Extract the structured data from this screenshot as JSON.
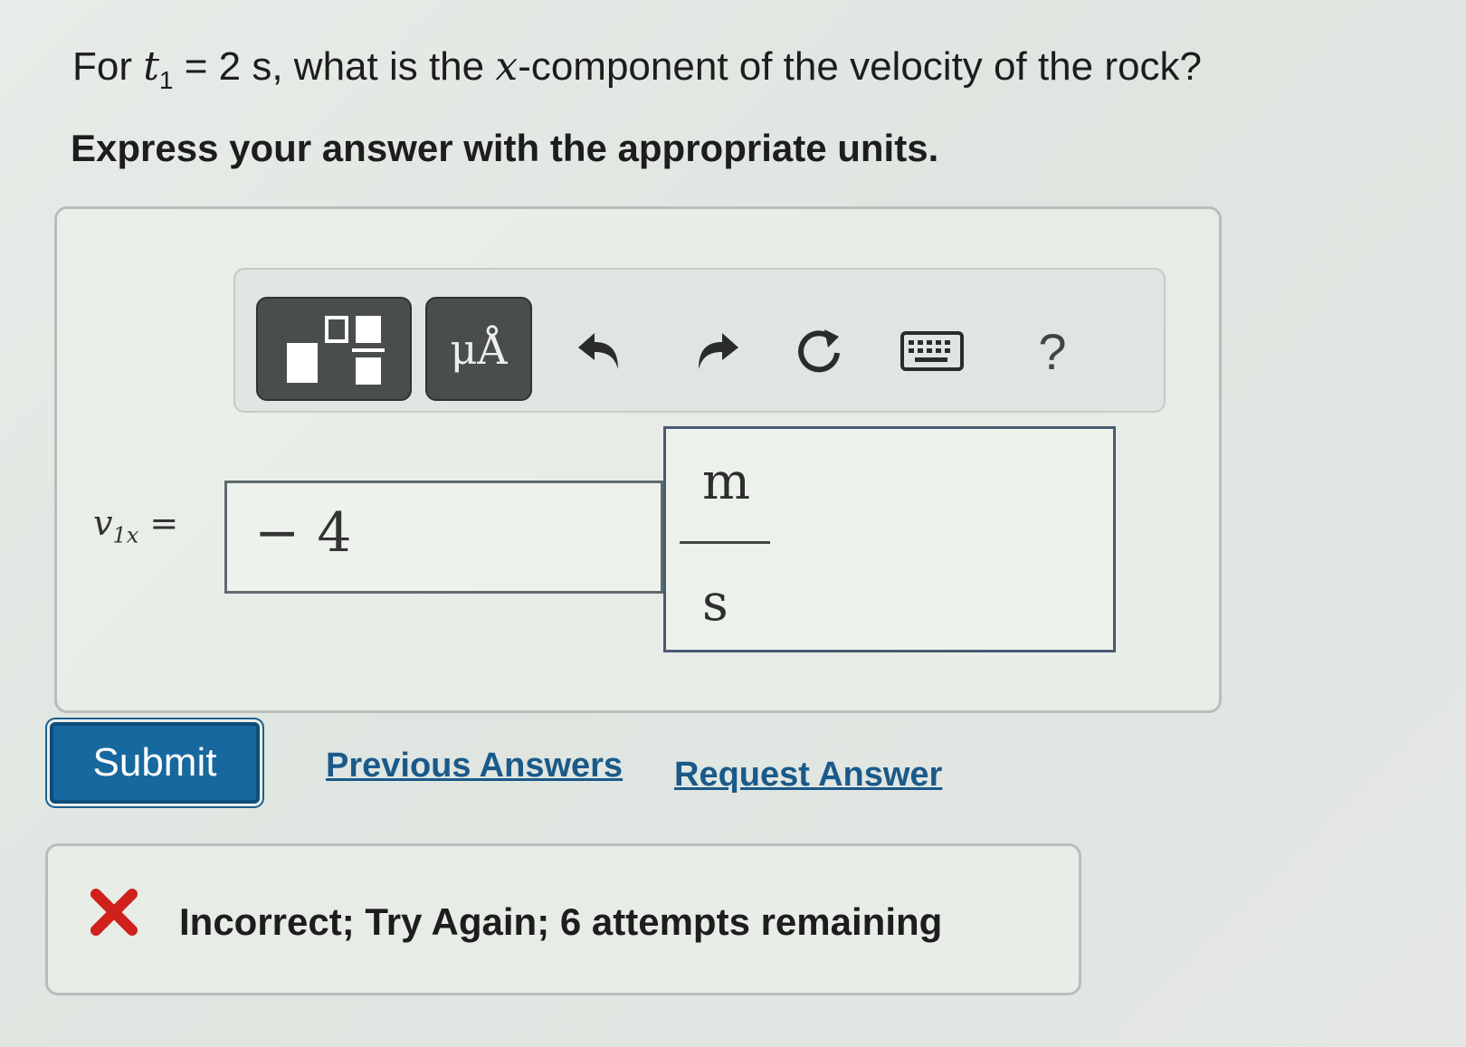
{
  "question": {
    "prefix": "For ",
    "var_t": "t",
    "var_t_sub": "1",
    "equals_value": " = 2 s, what is the ",
    "var_x": "x",
    "suffix": "-component of the velocity of the rock?"
  },
  "instruction": "Express your answer with the appropriate units.",
  "toolbar": {
    "templates_icon": "templates-icon",
    "units_label": "μÅ",
    "undo_icon": "undo-icon",
    "redo_icon": "redo-icon",
    "reset_icon": "reset-icon",
    "keyboard_icon": "keyboard-icon",
    "help_label": "?"
  },
  "answer": {
    "var_v": "v",
    "var_sub": "1x",
    "equals": " =",
    "value": "− 4",
    "unit_numerator": "m",
    "unit_denominator": "s"
  },
  "actions": {
    "submit_label": "Submit",
    "previous_answers_label": "Previous Answers",
    "request_answer_label": "Request Answer"
  },
  "feedback": {
    "icon": "incorrect-x-icon",
    "text": "Incorrect; Try Again; 6 attempts remaining",
    "icon_color": "#d0201c"
  },
  "colors": {
    "submit_bg": "#16689e",
    "link": "#1a5a8a"
  }
}
